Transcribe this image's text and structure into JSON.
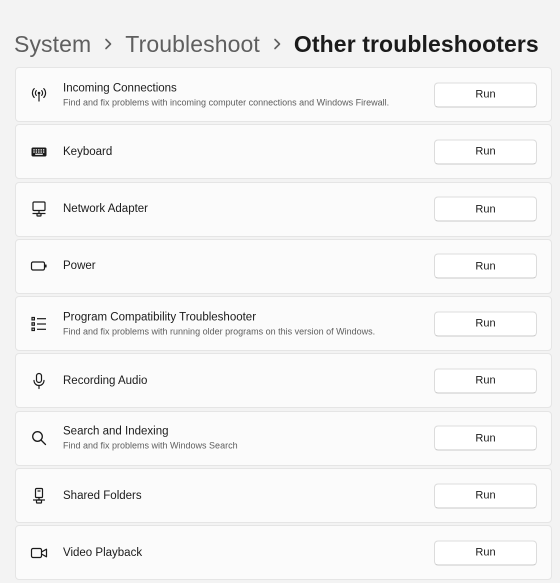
{
  "breadcrumb": {
    "items": [
      "System",
      "Troubleshoot",
      "Other troubleshooters"
    ]
  },
  "troubleshooters": [
    {
      "icon": "antenna-icon",
      "title": "Incoming Connections",
      "description": "Find and fix problems with incoming computer connections and Windows Firewall.",
      "button": "Run"
    },
    {
      "icon": "keyboard-icon",
      "title": "Keyboard",
      "description": "",
      "button": "Run"
    },
    {
      "icon": "network-adapter-icon",
      "title": "Network Adapter",
      "description": "",
      "button": "Run"
    },
    {
      "icon": "battery-icon",
      "title": "Power",
      "description": "",
      "button": "Run"
    },
    {
      "icon": "list-icon",
      "title": "Program Compatibility Troubleshooter",
      "description": "Find and fix problems with running older programs on this version of Windows.",
      "button": "Run"
    },
    {
      "icon": "microphone-icon",
      "title": "Recording Audio",
      "description": "",
      "button": "Run"
    },
    {
      "icon": "search-icon",
      "title": "Search and Indexing",
      "description": "Find and fix problems with Windows Search",
      "button": "Run"
    },
    {
      "icon": "shared-folder-icon",
      "title": "Shared Folders",
      "description": "",
      "button": "Run"
    },
    {
      "icon": "video-camera-icon",
      "title": "Video Playback",
      "description": "",
      "button": "Run"
    }
  ]
}
